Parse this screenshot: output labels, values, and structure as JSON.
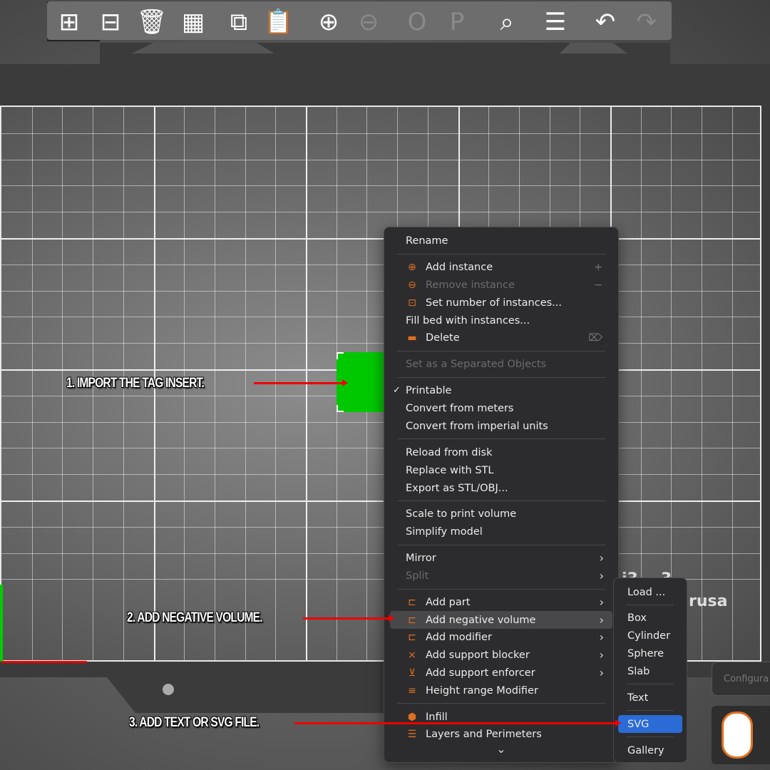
{
  "toolbar": {
    "buttons": [
      {
        "name": "add-object",
        "icon": "cube-plus-icon",
        "glyph": "⊞",
        "disabled": false
      },
      {
        "name": "delete-object",
        "icon": "cube-minus-icon",
        "glyph": "⊟",
        "disabled": false
      },
      {
        "name": "delete-all",
        "icon": "trash-icon",
        "glyph": "🗑",
        "disabled": false
      },
      {
        "name": "arrange",
        "icon": "arrange-icon",
        "glyph": "▦",
        "disabled": false
      },
      {
        "name": "copy",
        "icon": "copy-icon",
        "glyph": "⧉",
        "disabled": false
      },
      {
        "name": "paste",
        "icon": "paste-icon",
        "glyph": "📋",
        "disabled": true
      },
      {
        "name": "add-instance",
        "icon": "plus-circle-icon",
        "glyph": "⊕",
        "disabled": false
      },
      {
        "name": "remove-instance",
        "icon": "minus-circle-icon",
        "glyph": "⊖",
        "disabled": true
      },
      {
        "name": "split-objects",
        "icon": "split-objects-icon",
        "glyph": "O",
        "disabled": true
      },
      {
        "name": "split-parts",
        "icon": "split-parts-icon",
        "glyph": "P",
        "disabled": true
      },
      {
        "name": "search",
        "icon": "search-icon",
        "glyph": "⌕",
        "disabled": false
      },
      {
        "name": "layers",
        "icon": "layers-icon",
        "glyph": "☰",
        "disabled": false
      },
      {
        "name": "undo",
        "icon": "undo-icon",
        "glyph": "↶",
        "disabled": false
      },
      {
        "name": "redo",
        "icon": "redo-icon",
        "glyph": "↷",
        "disabled": true
      }
    ]
  },
  "bed_label": {
    "line1": "i3 .. 3",
    "line2": "rusa"
  },
  "context_menu": {
    "items": [
      {
        "label": "Rename"
      },
      {
        "sep": true
      },
      {
        "label": "Add instance",
        "icon": "plus-circle-icon",
        "glyph": "⊕",
        "shortcut": "+"
      },
      {
        "label": "Remove instance",
        "icon": "minus-circle-icon",
        "glyph": "⊖",
        "shortcut": "−",
        "disabled": true
      },
      {
        "label": "Set number of instances...",
        "icon": "instances-icon",
        "glyph": "⊡"
      },
      {
        "label": "Fill bed with instances..."
      },
      {
        "label": "Delete",
        "icon": "trash-icon",
        "glyph": "▬",
        "shortcut": "⌦"
      },
      {
        "sep": true
      },
      {
        "label": "Set as a Separated Objects",
        "disabled": true
      },
      {
        "sep": true
      },
      {
        "label": "Printable",
        "checked": true
      },
      {
        "label": "Convert from meters"
      },
      {
        "label": "Convert from imperial units"
      },
      {
        "sep": true
      },
      {
        "label": "Reload from disk"
      },
      {
        "label": "Replace with STL"
      },
      {
        "label": "Export as STL/OBJ..."
      },
      {
        "sep": true
      },
      {
        "label": "Scale to print volume"
      },
      {
        "label": "Simplify model"
      },
      {
        "sep": true
      },
      {
        "label": "Mirror",
        "submenu": true
      },
      {
        "label": "Split",
        "submenu": true,
        "disabled": true
      },
      {
        "sep": true
      },
      {
        "label": "Add part",
        "icon": "add-part-icon",
        "glyph": "⊏",
        "submenu": true
      },
      {
        "label": "Add negative volume",
        "icon": "negative-volume-icon",
        "glyph": "⊏",
        "submenu": true,
        "highlighted": true
      },
      {
        "label": "Add modifier",
        "icon": "modifier-icon",
        "glyph": "⊏",
        "submenu": true
      },
      {
        "label": "Add support blocker",
        "icon": "support-blocker-icon",
        "glyph": "⨯",
        "submenu": true
      },
      {
        "label": "Add support enforcer",
        "icon": "support-enforcer-icon",
        "glyph": "⊻",
        "submenu": true
      },
      {
        "label": "Height range Modifier",
        "icon": "height-range-icon",
        "glyph": "≡"
      },
      {
        "sep": true
      },
      {
        "label": "Infill",
        "icon": "infill-icon",
        "glyph": "⬢"
      },
      {
        "label": "Layers and Perimeters",
        "icon": "layers-icon",
        "glyph": "☰"
      }
    ],
    "more": "⌄"
  },
  "submenu": {
    "items": [
      {
        "label": "Load ..."
      },
      {
        "sep": true
      },
      {
        "label": "Box"
      },
      {
        "label": "Cylinder"
      },
      {
        "label": "Sphere"
      },
      {
        "label": "Slab"
      },
      {
        "sep": true
      },
      {
        "label": "Text"
      },
      {
        "sep": true
      },
      {
        "label": "SVG",
        "selected": true
      },
      {
        "sep": true
      },
      {
        "label": "Gallery"
      }
    ]
  },
  "annotations": {
    "step1": "1. IMPORT THE TAG INSERT.",
    "step2": "2. ADD NEGATIVE VOLUME.",
    "step3": "3. ADD TEXT OR SVG FILE."
  },
  "sidebar": {
    "configure_label": "Configura"
  },
  "colors": {
    "accent": "#e07020",
    "selection": "#2a6bd6",
    "object": "#00c800",
    "arrow": "#ee0000"
  }
}
